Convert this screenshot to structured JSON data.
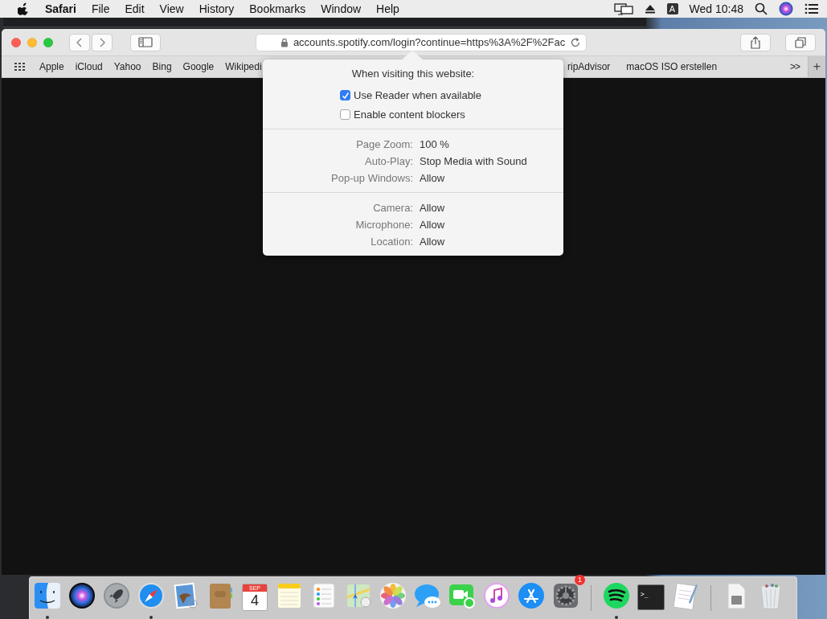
{
  "menu_bar": {
    "app_name": "Safari",
    "menus": [
      "File",
      "Edit",
      "View",
      "History",
      "Bookmarks",
      "Window",
      "Help"
    ],
    "input_source": "A",
    "clock": "Wed 10:48"
  },
  "toolbar": {
    "address": "accounts.spotify.com/login?continue=https%3A%2F%2Fac"
  },
  "bookmarks_bar": {
    "left_items": [
      "Apple",
      "iCloud",
      "Yahoo",
      "Bing",
      "Google",
      "Wikipedi"
    ],
    "right_items": [
      "ripAdvisor",
      "macOS ISO erstellen"
    ],
    "overflow": ">>",
    "add": "+"
  },
  "popover": {
    "heading": "When visiting this website:",
    "options": [
      {
        "label": "Use Reader when available",
        "checked": true
      },
      {
        "label": "Enable content blockers",
        "checked": false
      }
    ],
    "groups": [
      [
        {
          "label": "Page Zoom:",
          "value": "100 %"
        },
        {
          "label": "Auto-Play:",
          "value": "Stop Media with Sound"
        },
        {
          "label": "Pop-up Windows:",
          "value": "Allow"
        }
      ],
      [
        {
          "label": "Camera:",
          "value": "Allow"
        },
        {
          "label": "Microphone:",
          "value": "Allow"
        },
        {
          "label": "Location:",
          "value": "Allow"
        }
      ]
    ]
  },
  "dock": [
    {
      "kind": "finder",
      "running": true
    },
    {
      "kind": "siri",
      "running": false
    },
    {
      "kind": "launchpad",
      "running": false
    },
    {
      "kind": "safari",
      "running": true
    },
    {
      "kind": "mail",
      "running": false
    },
    {
      "kind": "contacts",
      "running": false
    },
    {
      "kind": "calendar",
      "running": false,
      "month": "SEP",
      "day": "4"
    },
    {
      "kind": "notes",
      "running": false
    },
    {
      "kind": "reminders",
      "running": false
    },
    {
      "kind": "maps",
      "running": false
    },
    {
      "kind": "photos",
      "running": false
    },
    {
      "kind": "messages",
      "running": false
    },
    {
      "kind": "facetime",
      "running": false
    },
    {
      "kind": "music",
      "running": false
    },
    {
      "kind": "appstore",
      "running": false
    },
    {
      "kind": "settings",
      "running": false,
      "badge": "1"
    },
    {
      "kind": "separator"
    },
    {
      "kind": "spotify",
      "running": true
    },
    {
      "kind": "terminal",
      "running": false,
      "prompt": ">_"
    },
    {
      "kind": "textedit",
      "running": false
    },
    {
      "kind": "separator"
    },
    {
      "kind": "downloads",
      "running": false
    },
    {
      "kind": "trash",
      "running": false
    }
  ]
}
